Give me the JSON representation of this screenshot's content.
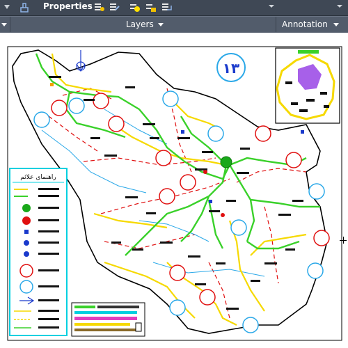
{
  "ribbon": {
    "properties_label": "Properties",
    "layers_label": "Layers",
    "annotation_label": "Annotation",
    "toolbar_icons": [
      "match-properties-icon",
      "layer-state-icon",
      "layer-match-icon",
      "layer-freeze-icon",
      "layer-lock-icon",
      "layer-previous-icon"
    ]
  },
  "map": {
    "sheet_number": "۱۳",
    "legend_title": "راهنمای علائم",
    "colors": {
      "border": "#000000",
      "frame": "#00d0e0",
      "road_main": "#ffeb00",
      "road_green": "#3ad12a",
      "boundary_red": "#e01010",
      "river": "#2aa8e8"
    }
  }
}
